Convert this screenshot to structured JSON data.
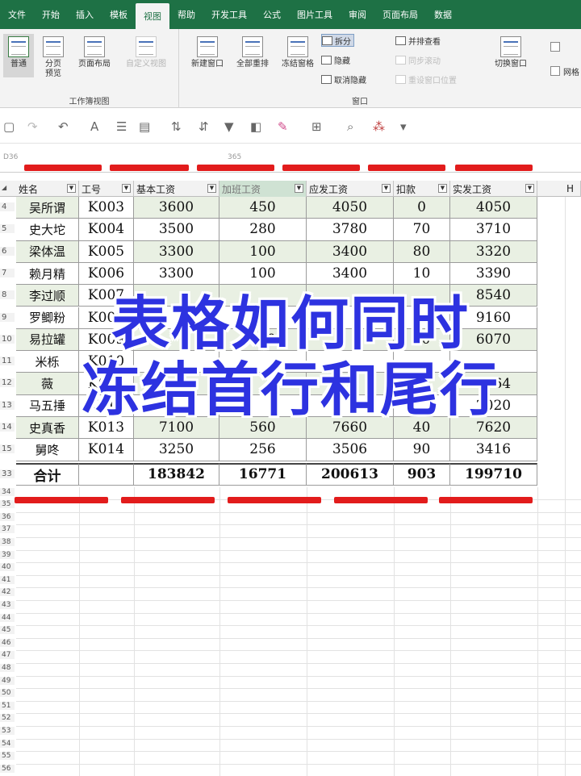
{
  "ribbon": {
    "tabs": [
      "文件",
      "开始",
      "插入",
      "模板",
      "视图",
      "帮助",
      "开发工具",
      "公式",
      "图片工具",
      "审阅",
      "页面布局",
      "数据"
    ],
    "active_tab": "视图",
    "groups": {
      "workbook_views": {
        "label": "工作簿视图",
        "buttons": [
          "普通",
          "分页\n预览",
          "页面布局",
          "自定义视图"
        ]
      },
      "window": {
        "label": "窗口",
        "buttons": [
          "新建窗口",
          "全部重排",
          "冻结窗格"
        ],
        "small_buttons": [
          "拆分",
          "隐藏",
          "取消隐藏",
          "并排查看",
          "同步滚动",
          "重设窗口位置"
        ],
        "switch": "切换窗口"
      },
      "show": {
        "label": "网格",
        "checkbox": "网格"
      }
    }
  },
  "formula_bar": {
    "namebox": "D36",
    "value": "365"
  },
  "headers": [
    "姓名",
    "工号",
    "基本工资",
    "加班工资",
    "应发工资",
    "扣款",
    "实发工资"
  ],
  "col_h": "H",
  "rows": [
    {
      "row": "4",
      "name": "吴所谓",
      "id": "K003",
      "base": "3600",
      "ot": "450",
      "gross": "4050",
      "ded": "0",
      "net": "4050"
    },
    {
      "row": "5",
      "name": "史大坨",
      "id": "K004",
      "base": "3500",
      "ot": "280",
      "gross": "3780",
      "ded": "70",
      "net": "3710"
    },
    {
      "row": "6",
      "name": "梁体温",
      "id": "K005",
      "base": "3300",
      "ot": "100",
      "gross": "3400",
      "ded": "80",
      "net": "3320"
    },
    {
      "row": "7",
      "name": "赖月精",
      "id": "K006",
      "base": "3300",
      "ot": "100",
      "gross": "3400",
      "ded": "10",
      "net": "3390"
    },
    {
      "row": "8",
      "name": "李过顺",
      "id": "K007",
      "base": "",
      "ot": "",
      "gross": "",
      "ded": "",
      "net": "8540"
    },
    {
      "row": "9",
      "name": "罗鲫粉",
      "id": "K008",
      "base": "",
      "ot": "",
      "gross": "",
      "ded": "",
      "net": "9160"
    },
    {
      "row": "10",
      "name": "易拉罐",
      "id": "K009",
      "base": "",
      "ot": "150",
      "gross": "",
      "ded": "30",
      "net": "6070"
    },
    {
      "row": "11",
      "name": "米栎",
      "id": "K010",
      "base": "",
      "ot": "",
      "gross": "",
      "ded": "",
      "net": ""
    },
    {
      "row": "12",
      "name": "薇",
      "id": "K011",
      "base": "",
      "ot": "",
      "gross": "",
      "ded": "",
      "net": "6164"
    },
    {
      "row": "13",
      "name": "马五捶",
      "id": "K012",
      "base": "",
      "ot": "",
      "gross": "",
      "ded": "",
      "net": "2020"
    },
    {
      "row": "14",
      "name": "史真香",
      "id": "K013",
      "base": "7100",
      "ot": "560",
      "gross": "7660",
      "ded": "40",
      "net": "7620"
    },
    {
      "row": "15",
      "name": "舅咚",
      "id": "K014",
      "base": "3250",
      "ot": "256",
      "gross": "3506",
      "ded": "90",
      "net": "3416"
    }
  ],
  "total": {
    "row": "33",
    "label": "合计",
    "id": "",
    "base": "183842",
    "ot": "16771",
    "gross": "200613",
    "ded": "903",
    "net": "199710"
  },
  "empty_rows": [
    "34",
    "35",
    "36",
    "37",
    "38",
    "39",
    "40",
    "41",
    "42",
    "43",
    "44",
    "45",
    "46",
    "47",
    "48",
    "49",
    "50",
    "51",
    "52",
    "53",
    "54",
    "55",
    "56"
  ],
  "caption": {
    "line1": "表格如何同时",
    "line2": "冻结首行和尾行"
  },
  "colors": {
    "ribbon_green": "#1e7145",
    "caption_blue": "#2d32e0",
    "red_bar": "#e21c1c",
    "cell_green": "#e9f0e3"
  }
}
